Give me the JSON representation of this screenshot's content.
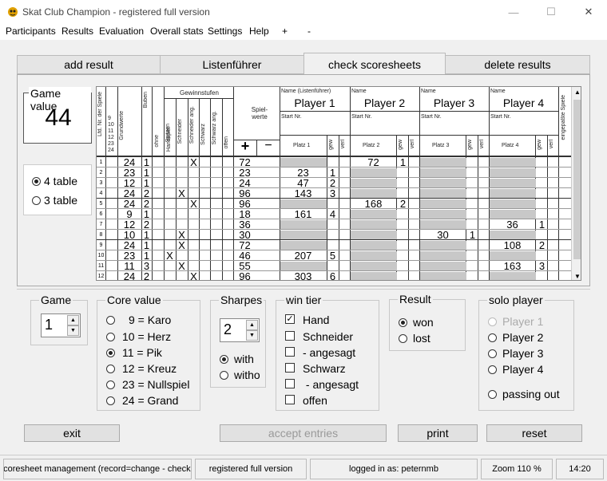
{
  "window": {
    "title": "Skat Club Champion - registered full version"
  },
  "menu": [
    "Participants",
    "Results",
    "Evaluation",
    "Overall stats",
    "Settings",
    "Help",
    "+",
    "-"
  ],
  "tabs": [
    "add result",
    "Listenführer",
    "check scoresheets",
    "delete results"
  ],
  "active_tab": "check scoresheets",
  "game_value": {
    "title": "Game value",
    "value": "44"
  },
  "table_options": {
    "four": "4 table",
    "three": "3 table",
    "selected": "4 table"
  },
  "sheet": {
    "headers": {
      "lfd": "Lfd. Nr. der Spiele",
      "grundwerte": "Grundwerte",
      "buben": "Buben",
      "ohne": "ohne",
      "spitzen": "Spitzen",
      "gewinnstufen": "Gewinnstufen",
      "handspiel": "Handspiel",
      "schneider": "Schneider",
      "schneider_ang": "Schneider ang.",
      "schwarz": "Schwarz",
      "schwarz_ang": "Schwarz ang.",
      "offen": "offen",
      "spielwerte": "Spiel-werte",
      "plus": "+",
      "minus": "−",
      "name_lf": "Name (Listenführer)",
      "name": "Name",
      "start_nr": "Start Nr.",
      "gew": "gew",
      "verl": "verl",
      "eingepasste": "eingepaßte Spiele",
      "base_values": [
        "9",
        "10",
        "11",
        "12",
        "23",
        "24"
      ]
    },
    "players": [
      {
        "name": "Player 1",
        "platz": "Platz 1"
      },
      {
        "name": "Player 2",
        "platz": "Platz 2"
      },
      {
        "name": "Player 3",
        "platz": "Platz 3"
      },
      {
        "name": "Player 4",
        "platz": "Platz 4"
      }
    ],
    "rows": [
      {
        "nr": "1",
        "grund": "24",
        "buben": "1",
        "marks": "X",
        "mark_col": 3,
        "wert": "72",
        "p": [
          "",
          "72",
          "",
          ""
        ],
        "w": [
          "",
          "1",
          "",
          ""
        ]
      },
      {
        "nr": "2",
        "grund": "23",
        "buben": "1",
        "marks": "",
        "mark_col": -1,
        "wert": "23",
        "p": [
          "23",
          "",
          "",
          ""
        ],
        "w": [
          "1",
          "",
          "",
          ""
        ]
      },
      {
        "nr": "3",
        "grund": "12",
        "buben": "1",
        "marks": "",
        "mark_col": -1,
        "wert": "24",
        "p": [
          "47",
          "",
          "",
          ""
        ],
        "w": [
          "2",
          "",
          "",
          ""
        ]
      },
      {
        "nr": "4",
        "grund": "24",
        "buben": "2",
        "marks": "X",
        "mark_col": 2,
        "wert": "96",
        "p": [
          "143",
          "",
          "",
          ""
        ],
        "w": [
          "3",
          "",
          "",
          ""
        ]
      },
      {
        "nr": "5",
        "grund": "24",
        "buben": "2",
        "marks": "X",
        "mark_col": 3,
        "wert": "96",
        "p": [
          "",
          "168",
          "",
          ""
        ],
        "w": [
          "",
          "2",
          "",
          ""
        ]
      },
      {
        "nr": "6",
        "grund": "9",
        "buben": "1",
        "marks": "",
        "mark_col": -1,
        "wert": "18",
        "p": [
          "161",
          "",
          "",
          ""
        ],
        "w": [
          "4",
          "",
          "",
          ""
        ]
      },
      {
        "nr": "7",
        "grund": "12",
        "buben": "2",
        "marks": "",
        "mark_col": -1,
        "wert": "36",
        "p": [
          "",
          "",
          "",
          "36"
        ],
        "w": [
          "",
          "",
          "",
          "1"
        ]
      },
      {
        "nr": "8",
        "grund": "10",
        "buben": "1",
        "marks": "X",
        "mark_col": 2,
        "wert": "30",
        "p": [
          "",
          "",
          "30",
          ""
        ],
        "w": [
          "",
          "",
          "1",
          ""
        ]
      },
      {
        "nr": "9",
        "grund": "24",
        "buben": "1",
        "marks": "X",
        "mark_col": 2,
        "wert": "72",
        "p": [
          "",
          "",
          "",
          "108"
        ],
        "w": [
          "",
          "",
          "",
          "2"
        ]
      },
      {
        "nr": "10",
        "grund": "23",
        "buben": "1",
        "marks": "X",
        "mark_col": 7,
        "wert": "46",
        "p": [
          "207",
          "",
          "",
          ""
        ],
        "w": [
          "5",
          "",
          "",
          ""
        ]
      },
      {
        "nr": "11",
        "grund": "11",
        "buben": "3",
        "marks": "X",
        "mark_col": 2,
        "wert": "55",
        "p": [
          "",
          "",
          "",
          "163"
        ],
        "w": [
          "",
          "",
          "",
          "3"
        ]
      },
      {
        "nr": "12",
        "grund": "24",
        "buben": "2",
        "marks": "X",
        "mark_col": 3,
        "wert": "96",
        "p": [
          "303",
          "",
          "",
          ""
        ],
        "w": [
          "6",
          "",
          "",
          ""
        ]
      }
    ]
  },
  "game": {
    "title": "Game",
    "value": "1"
  },
  "core_value": {
    "title": "Core value",
    "options": [
      "9 = Karo",
      "10 = Herz",
      "11 = Pik",
      "12 = Kreuz",
      "23 = Nullspiel",
      "24 = Grand"
    ],
    "selected": "11 = Pik"
  },
  "sharpes": {
    "title": "Sharpes",
    "value": "2",
    "with": "with",
    "without": "witho",
    "selected": "with"
  },
  "win_tier": {
    "title": "win tier",
    "options": [
      {
        "label": "Hand",
        "checked": true
      },
      {
        "label": "Schneider",
        "checked": false
      },
      {
        "label": "- angesagt",
        "checked": false
      },
      {
        "label": "Schwarz",
        "checked": false
      },
      {
        "label": " - angesagt",
        "checked": false
      },
      {
        "label": "offen",
        "checked": false
      }
    ]
  },
  "result": {
    "title": "Result",
    "won": "won",
    "lost": "lost",
    "selected": "won"
  },
  "solo_player": {
    "title": "solo player",
    "options": [
      "Player 1",
      "Player 2",
      "Player 3",
      "Player 4"
    ],
    "disabled": "Player 1",
    "passing": "passing out"
  },
  "buttons": {
    "exit": "exit",
    "accept": "accept entries",
    "print": "print",
    "reset": "reset"
  },
  "status": {
    "mode": "scoresheet management (record=change - check -",
    "license": "registered full version",
    "user": "logged in as: peternmb",
    "zoom": "Zoom 110 %",
    "time": "14:20"
  },
  "colors": {
    "shade": "#c8c8c8",
    "panel": "#f0f0f0"
  }
}
